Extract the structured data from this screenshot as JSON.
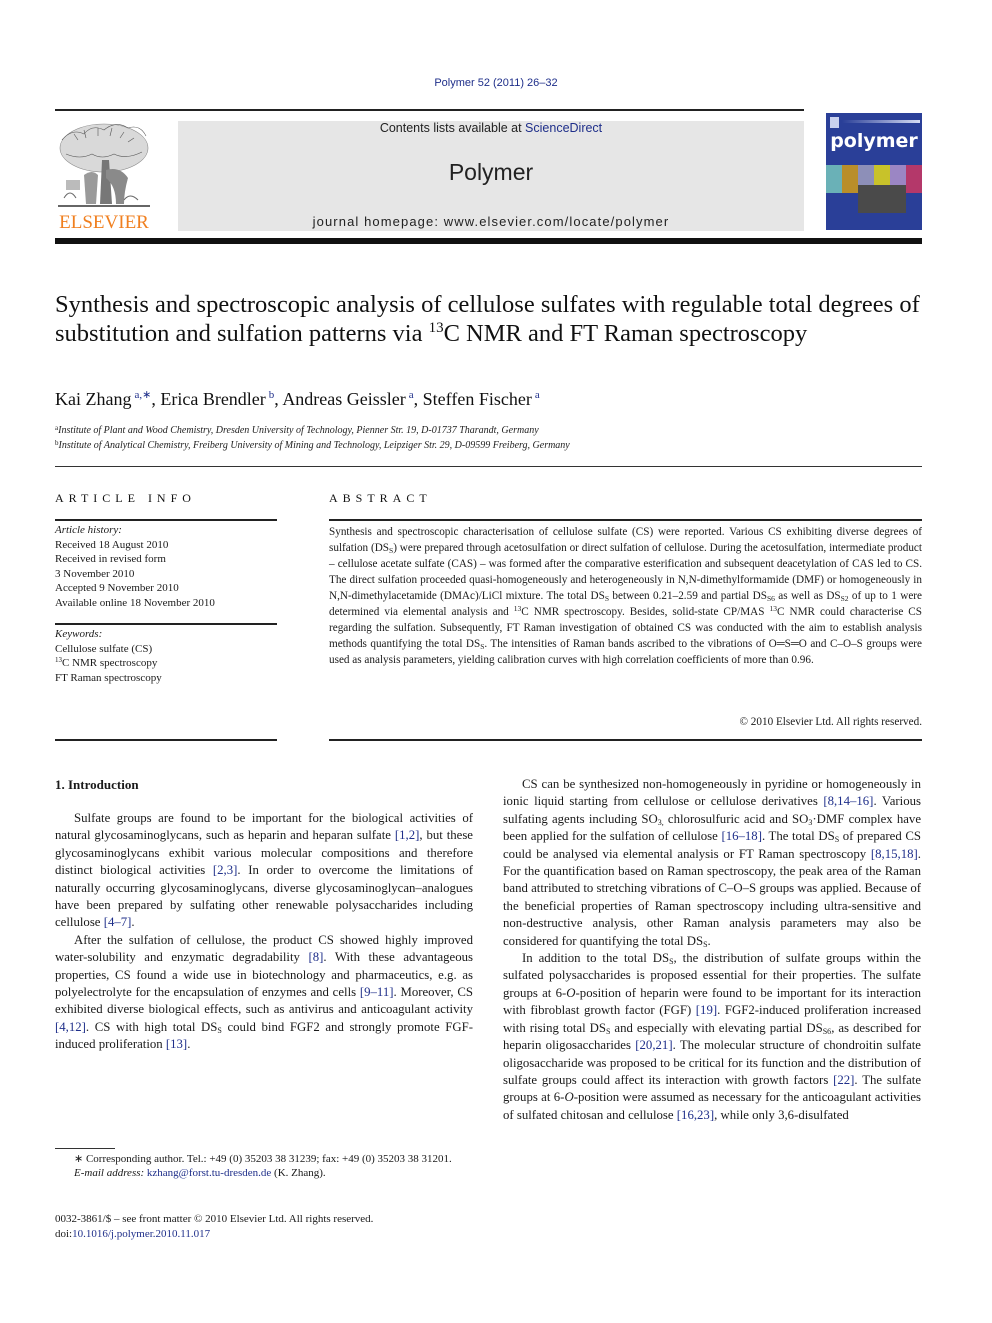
{
  "header": {
    "citation": "Polymer 52 (2011) 26–32",
    "publisher_wordmark": "ELSEVIER",
    "contents_prefix": "Contents lists available at ",
    "contents_link": "ScienceDirect",
    "journal_name": "Polymer",
    "homepage": "journal homepage: www.elsevier.com/locate/polymer",
    "cover_title": "polymer",
    "colors": {
      "link": "#1f2f8a",
      "elsevier_orange": "#f07f1f",
      "cover_blue": "#2a3f98",
      "banner_gray": "#e6e6e6"
    }
  },
  "article": {
    "title_part1": "Synthesis and spectroscopic analysis of cellulose sulfates with regulable total degrees of substitution and sulfation patterns via ",
    "title_sup": "13",
    "title_part2": "C NMR and FT Raman spectroscopy",
    "authors": [
      {
        "name": "Kai Zhang",
        "affil": "a,∗"
      },
      {
        "name": "Erica Brendler",
        "affil": "b"
      },
      {
        "name": "Andreas Geissler",
        "affil": "a"
      },
      {
        "name": "Steffen Fischer",
        "affil": "a"
      }
    ],
    "affiliations": [
      {
        "mark": "a",
        "text": "Institute of Plant and Wood Chemistry, Dresden University of Technology, Pienner Str. 19, D-01737 Tharandt, Germany"
      },
      {
        "mark": "b",
        "text": "Institute of Analytical Chemistry, Freiberg University of Mining and Technology, Leipziger Str. 29, D-09599 Freiberg, Germany"
      }
    ]
  },
  "article_info": {
    "heading": "ARTICLE INFO",
    "history_label": "Article history:",
    "history": [
      "Received 18 August 2010",
      "Received in revised form",
      "3 November 2010",
      "Accepted 9 November 2010",
      "Available online 18 November 2010"
    ],
    "keywords_label": "Keywords:",
    "keywords": [
      {
        "pre": "",
        "sup": "",
        "text": "Cellulose sulfate (CS)"
      },
      {
        "pre": "",
        "sup": "13",
        "text": "C NMR spectroscopy"
      },
      {
        "pre": "",
        "sup": "",
        "text": "FT Raman spectroscopy"
      }
    ]
  },
  "abstract": {
    "heading": "ABSTRACT",
    "s1": "Synthesis and spectroscopic characterisation of cellulose sulfate (CS) were reported. Various CS exhibiting diverse degrees of sulfation (DS",
    "s1_sub": "S",
    "s2": ") were prepared through acetosulfation or direct sulfation of cellulose. During the acetosulfation, intermediate product – cellulose acetate sulfate (CAS) – was formed after the comparative esterification and subsequent deacetylation of CAS led to CS. The direct sulfation proceeded quasi-homogeneously and heterogeneously in N,N-dimethylformamide (DMF) or homogeneously in N,N-dimethylacetamide (DMAc)/LiCl mixture. The total DS",
    "s2_sub": "S",
    "s3": " between 0.21–2.59 and partial DS",
    "s3_sub": "S6",
    "s4": " as well as DS",
    "s4_sub": "S2",
    "s5": " of up to 1 were determined via elemental analysis and ",
    "s5_sup": "13",
    "s6": "C NMR spectroscopy. Besides, solid-state CP/MAS ",
    "s6_sup": "13",
    "s7": "C NMR could characterise CS regarding the sulfation. Subsequently, FT Raman investigation of obtained CS was conducted with the aim to establish analysis methods quantifying the total DS",
    "s7_sub": "S",
    "s8": ". The intensities of Raman bands ascribed to the vibrations of O═S═O and C–O–S groups were used as analysis parameters, yielding calibration curves with high correlation coefficients of more than 0.96.",
    "copyright": "© 2010 Elsevier Ltd. All rights reserved."
  },
  "intro": {
    "heading": "1.  Introduction",
    "p1": [
      {
        "t": "Sulfate groups are found to be important for the biological activities of natural glycosaminoglycans, such as heparin and heparan sulfate "
      },
      {
        "r": "[1,2]"
      },
      {
        "t": ", but these glycosaminoglycans exhibit various molecular compositions and therefore distinct biological activities "
      },
      {
        "r": "[2,3]"
      },
      {
        "t": ". In order to overcome the limitations of naturally occurring glycosaminoglycans, diverse glycosaminoglycan–analogues have been prepared by sulfating other renewable polysaccharides including cellulose "
      },
      {
        "r": "[4–7]"
      },
      {
        "t": "."
      }
    ],
    "p2": [
      {
        "t": "After the sulfation of cellulose, the product CS showed highly improved water-solubility and enzymatic degradability "
      },
      {
        "r": "[8]"
      },
      {
        "t": ". With these advantageous properties, CS found a wide use in biotechnology and pharmaceutics, e.g. as polyelectrolyte for the encapsulation of enzymes and cells "
      },
      {
        "r": "[9–11]"
      },
      {
        "t": ". Moreover, CS exhibited diverse biological effects, such as antivirus and anticoagulant activity "
      },
      {
        "r": "[4,12]"
      },
      {
        "t": ". CS with high total DS"
      },
      {
        "s": "S"
      },
      {
        "t": " could bind FGF2 and strongly promote FGF-induced proliferation "
      },
      {
        "r": "[13]"
      },
      {
        "t": "."
      }
    ],
    "p3": [
      {
        "t": "CS can be synthesized non-homogeneously in pyridine or homogeneously in ionic liquid starting from cellulose or cellulose derivatives "
      },
      {
        "r": "[8,14–16]"
      },
      {
        "t": ". Various sulfating agents including SO"
      },
      {
        "s": "3,"
      },
      {
        "t": " chlorosulfuric acid and SO"
      },
      {
        "s": "3"
      },
      {
        "t": "·DMF complex have been applied for the sulfation of cellulose "
      },
      {
        "r": "[16–18]"
      },
      {
        "t": ". The total DS"
      },
      {
        "s": "S"
      },
      {
        "t": " of prepared CS could be analysed via elemental analysis or FT Raman spectroscopy "
      },
      {
        "r": "[8,15,18]"
      },
      {
        "t": ". For the quantification based on Raman spectroscopy, the peak area of the Raman band attributed to stretching vibrations of C–O–S groups was applied. Because of the beneficial properties of Raman spectroscopy including ultra-sensitive and non-destructive analysis, other Raman analysis parameters may also be considered for quantifying the total DS"
      },
      {
        "s": "S"
      },
      {
        "t": "."
      }
    ],
    "p4": [
      {
        "t": "In addition to the total DS"
      },
      {
        "s": "S"
      },
      {
        "t": ", the distribution of sulfate groups within the sulfated polysaccharides is proposed essential for their properties. The sulfate groups at 6-"
      },
      {
        "i": "O"
      },
      {
        "t": "-position of heparin were found to be important for its interaction with fibroblast growth factor (FGF) "
      },
      {
        "r": "[19]"
      },
      {
        "t": ". FGF2-induced proliferation increased with rising total DS"
      },
      {
        "s": "S"
      },
      {
        "t": " and especially with elevating partial DS"
      },
      {
        "s": "S6"
      },
      {
        "t": ", as described for heparin oligosaccharides "
      },
      {
        "r": "[20,21]"
      },
      {
        "t": ". The molecular structure of chondroitin sulfate oligosaccharide was proposed to be critical for its function and the distribution of sulfate groups could affect its interaction with growth factors "
      },
      {
        "r": "[22]"
      },
      {
        "t": ". The sulfate groups at 6-"
      },
      {
        "i": "O"
      },
      {
        "t": "-position were assumed as necessary for the anticoagulant activities of sulfated chitosan and cellulose "
      },
      {
        "r": "[16,23]"
      },
      {
        "t": ", while only 3,6-disulfated"
      }
    ]
  },
  "footnote": {
    "corresponding": "∗ Corresponding author. Tel.: +49 (0) 35203 38 31239; fax: +49 (0) 35203 38 31201.",
    "email_label": "E-mail address:",
    "email": "kzhang@forst.tu-dresden.de",
    "email_suffix": " (K. Zhang).",
    "front_matter": "0032-3861/$ – see front matter © 2010 Elsevier Ltd. All rights reserved.",
    "doi_prefix": "doi:",
    "doi": "10.1016/j.polymer.2010.11.017"
  }
}
